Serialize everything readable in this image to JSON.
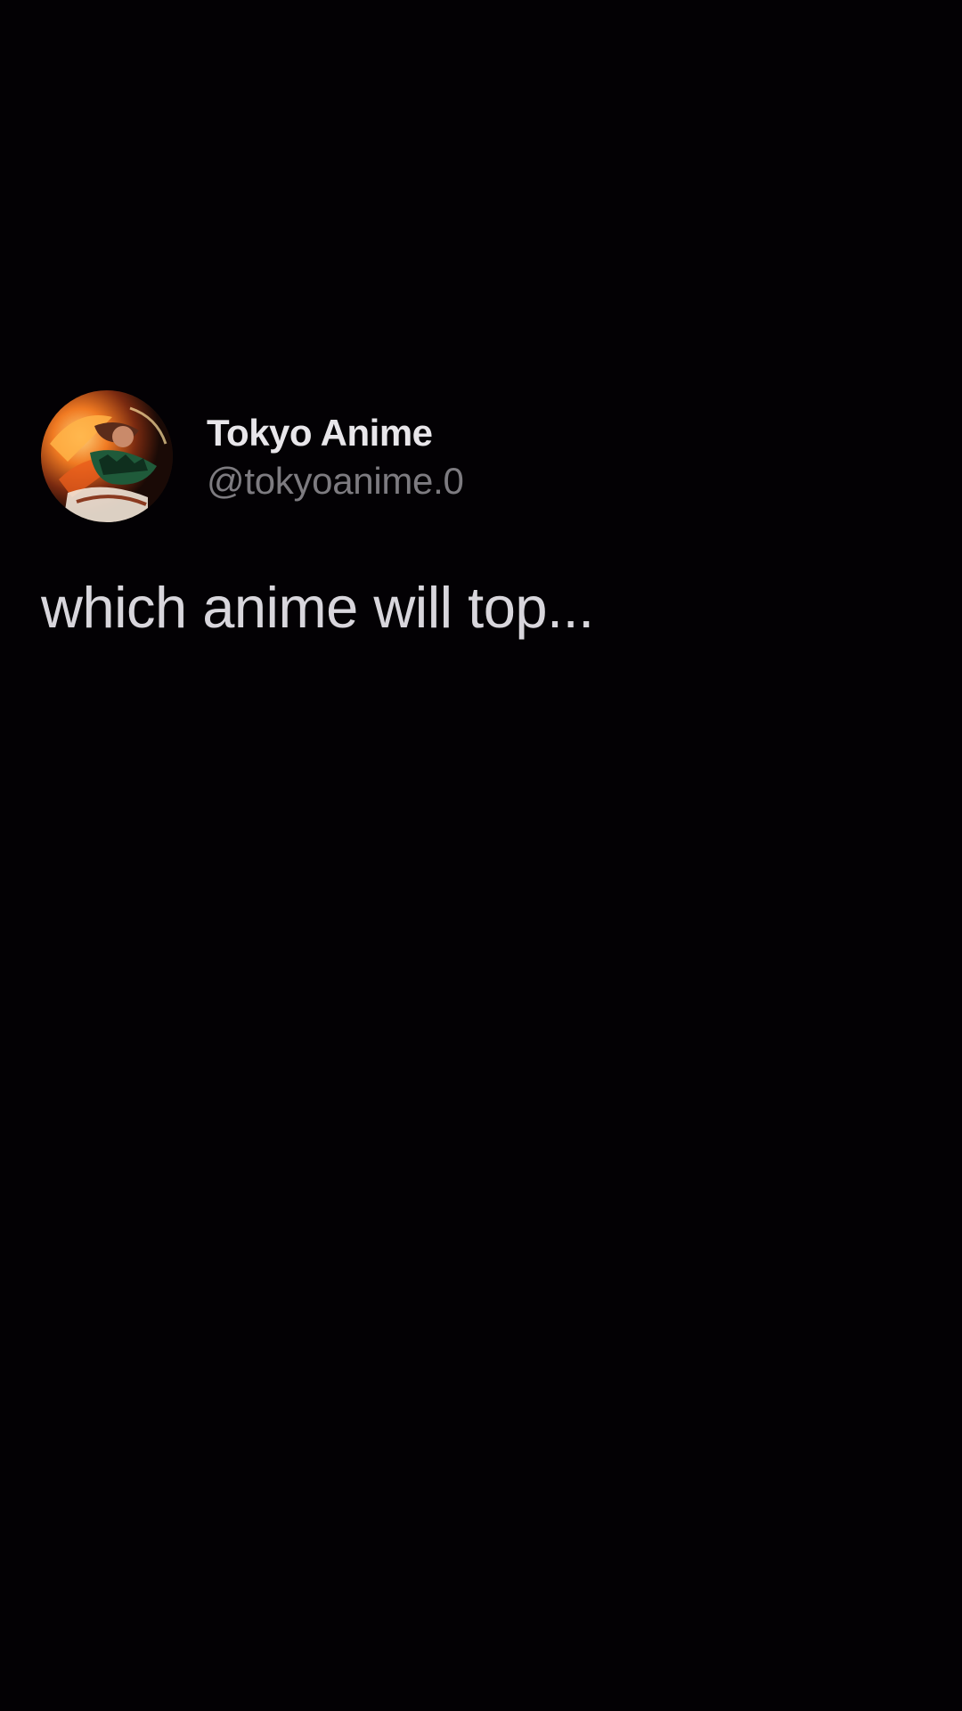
{
  "post": {
    "author_name": "Tokyo Anime",
    "author_handle": "@tokyoanime.0",
    "avatar_icon": "anime-character-avatar",
    "text": "which anime will top..."
  },
  "colors": {
    "background": "#030104",
    "name": "#e8e6ea",
    "handle": "#7d7b80",
    "text": "#d8d6dc"
  }
}
